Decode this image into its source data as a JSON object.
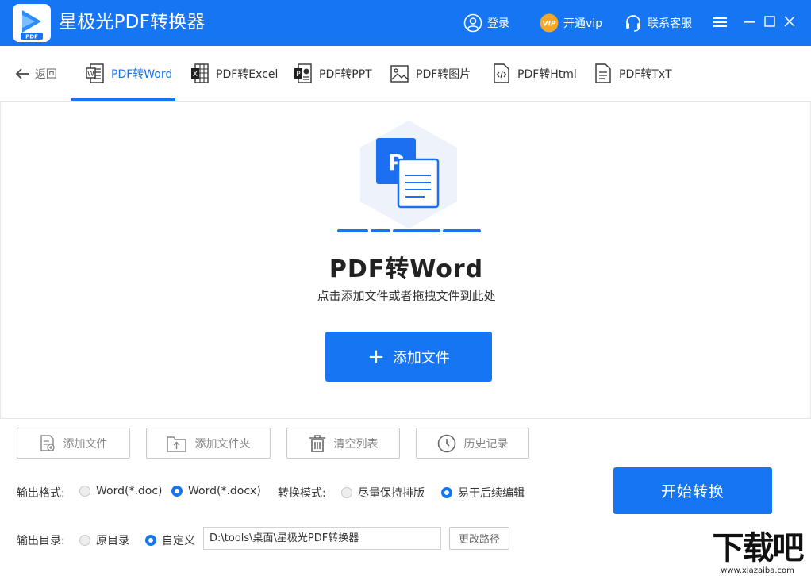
{
  "titlebar": {
    "app_title": "星极光PDF转换器",
    "login_label": "登录",
    "vip_label": "开通vip",
    "vip_badge": "VIP",
    "service_label": "联系客服"
  },
  "tabbar": {
    "back_label": "返回",
    "tabs": [
      {
        "label": "PDF转Word",
        "icon": "word-file-icon",
        "active": true
      },
      {
        "label": "PDF转Excel",
        "icon": "excel-file-icon",
        "active": false
      },
      {
        "label": "PDF转PPT",
        "icon": "ppt-file-icon",
        "active": false
      },
      {
        "label": "PDF转图片",
        "icon": "image-file-icon",
        "active": false
      },
      {
        "label": "PDF转Html",
        "icon": "html-file-icon",
        "active": false
      },
      {
        "label": "PDF转TxT",
        "icon": "txt-file-icon",
        "active": false
      }
    ]
  },
  "main": {
    "title": "PDF转Word",
    "subtitle": "点击添加文件或者拖拽文件到此处",
    "add_file_label": "添加文件",
    "hero_letter": "P"
  },
  "bottom": {
    "tools": [
      {
        "label": "添加文件",
        "icon": "add-file-icon"
      },
      {
        "label": "添加文件夹",
        "icon": "add-folder-icon"
      },
      {
        "label": "清空列表",
        "icon": "trash-icon"
      },
      {
        "label": "历史记录",
        "icon": "clock-icon"
      }
    ],
    "output_format_label": "输出格式:",
    "format_options": [
      {
        "label": "Word(*.doc)",
        "selected": false
      },
      {
        "label": "Word(*.docx)",
        "selected": true
      }
    ],
    "convert_mode_label": "转换模式:",
    "mode_options": [
      {
        "label": "尽量保持排版",
        "selected": false
      },
      {
        "label": "易于后续编辑",
        "selected": true
      }
    ],
    "output_dir_label": "输出目录:",
    "dir_options": [
      {
        "label": "原目录",
        "selected": false
      },
      {
        "label": "自定义",
        "selected": true
      }
    ],
    "path_value": "D:\\tools\\桌面\\星极光PDF转换器",
    "change_path_label": "更改路径",
    "start_label": "开始转换"
  },
  "watermark": {
    "big": "下载吧",
    "small": "www.xiazaiba.com"
  },
  "colors": {
    "accent": "#1675f3",
    "vip": "#f5a623"
  }
}
